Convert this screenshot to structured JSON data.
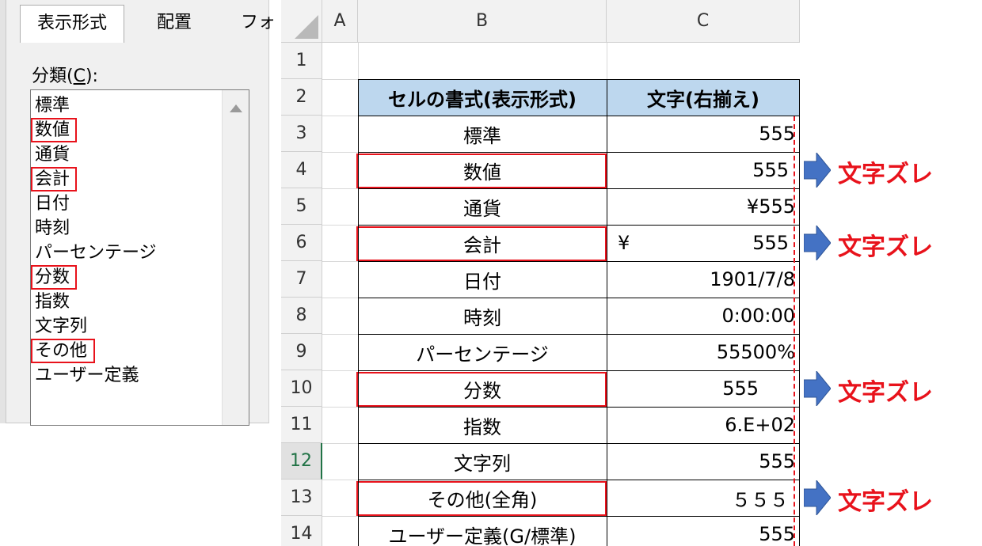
{
  "dialog": {
    "tabs": [
      "表示形式",
      "配置",
      "フォ"
    ],
    "category_label_prefix": "分類(",
    "category_label_key": "C",
    "category_label_suffix": "):",
    "categories": [
      {
        "label": "標準",
        "highlighted": false
      },
      {
        "label": "数値",
        "highlighted": true
      },
      {
        "label": "通貨",
        "highlighted": false
      },
      {
        "label": "会計",
        "highlighted": true
      },
      {
        "label": "日付",
        "highlighted": false
      },
      {
        "label": "時刻",
        "highlighted": false
      },
      {
        "label": "パーセンテージ",
        "highlighted": false
      },
      {
        "label": "分数",
        "highlighted": true
      },
      {
        "label": "指数",
        "highlighted": false
      },
      {
        "label": "文字列",
        "highlighted": false
      },
      {
        "label": "その他",
        "highlighted": true
      },
      {
        "label": "ユーザー定義",
        "highlighted": false
      }
    ]
  },
  "sheet": {
    "columns": [
      "A",
      "B",
      "C"
    ],
    "rows": [
      "1",
      "2",
      "3",
      "4",
      "5",
      "6",
      "7",
      "8",
      "9",
      "10",
      "11",
      "12",
      "13",
      "14"
    ],
    "selected_row": "12",
    "table_header": {
      "b": "セルの書式(表示形式)",
      "c": "文字(右揃え)"
    },
    "table_rows": [
      {
        "row": "3",
        "b": "標準",
        "c": "555",
        "c_prefix": "",
        "highlighted": false
      },
      {
        "row": "4",
        "b": "数値",
        "c": "555",
        "c_prefix": "",
        "highlighted": true
      },
      {
        "row": "5",
        "b": "通貨",
        "c": "¥555",
        "c_prefix": "",
        "highlighted": false
      },
      {
        "row": "6",
        "b": "会計",
        "c": "555",
        "c_prefix": "¥",
        "highlighted": true
      },
      {
        "row": "7",
        "b": "日付",
        "c": "1901/7/8",
        "c_prefix": "",
        "highlighted": false
      },
      {
        "row": "8",
        "b": "時刻",
        "c": "0:00:00",
        "c_prefix": "",
        "highlighted": false
      },
      {
        "row": "9",
        "b": "パーセンテージ",
        "c": "55500%",
        "c_prefix": "",
        "highlighted": false
      },
      {
        "row": "10",
        "b": "分数",
        "c": "555",
        "c_prefix": "",
        "highlighted": true
      },
      {
        "row": "11",
        "b": "指数",
        "c": "6.E+02",
        "c_prefix": "",
        "highlighted": false
      },
      {
        "row": "12",
        "b": "文字列",
        "c": "555",
        "c_prefix": "",
        "highlighted": false
      },
      {
        "row": "13",
        "b": "その他(全角)",
        "c": "５５５",
        "c_prefix": "",
        "highlighted": true
      },
      {
        "row": "14",
        "b": "ユーザー定義(G/標準)",
        "c": "555",
        "c_prefix": "",
        "highlighted": false
      }
    ]
  },
  "annotations": {
    "note": "文字ズレ",
    "arrow_color": "#4472c4",
    "highlight_color": "#e8121b"
  }
}
